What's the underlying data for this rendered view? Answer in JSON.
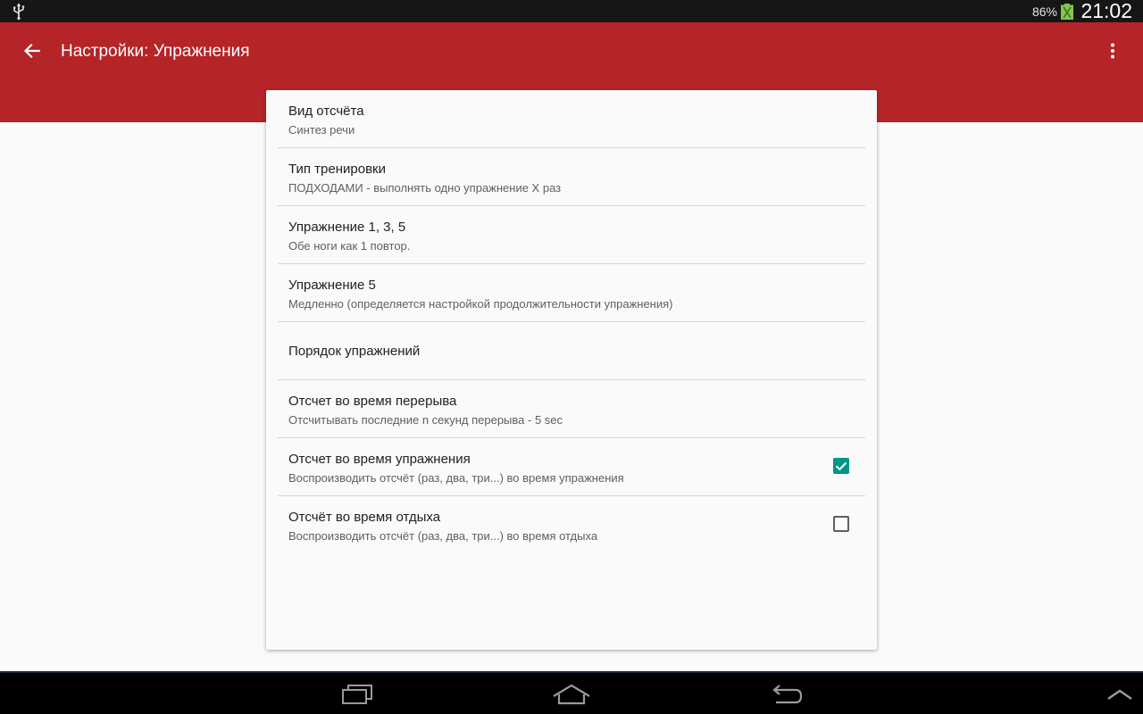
{
  "status_bar": {
    "battery_percent": "86%",
    "time": "21:02",
    "icons": [
      "usb-icon",
      "battery-charging-icon"
    ]
  },
  "app_bar": {
    "title": "Настройки: Упражнения",
    "back_icon": "arrow-left-icon",
    "menu_icon": "more-vert-icon",
    "color": "#b52427"
  },
  "preferences": [
    {
      "title": "Вид отсчёта",
      "summary": "Синтез речи"
    },
    {
      "title": "Тип тренировки",
      "summary": "ПОДХОДАМИ - выполнять одно упражнение X раз"
    },
    {
      "title": "Упражнение 1, 3, 5",
      "summary": "Обе ноги как 1 повтор."
    },
    {
      "title": "Упражнение 5",
      "summary": "Медленно (определяется настройкой продолжительности упражнения)"
    },
    {
      "title": "Порядок упражнений"
    },
    {
      "title": "Отсчет во время перерыва",
      "summary": "Отсчитывать последние n секунд перерыва - 5 sec"
    },
    {
      "title": "Отсчет во время упражнения",
      "summary": "Воспроизводить отсчёт (раз, два, три...) во время упражнения",
      "checked": true
    },
    {
      "title": "Отсчёт во время отдыха",
      "summary": "Воспроизводить отсчёт (раз, два, три...) во время отдыха",
      "checked": false
    }
  ],
  "nav_bar": {
    "icons": [
      "recent-apps-icon",
      "home-icon",
      "back-icon",
      "chevron-up-icon"
    ]
  },
  "colors": {
    "accent": "#00968a",
    "app_bar": "#b52427"
  }
}
